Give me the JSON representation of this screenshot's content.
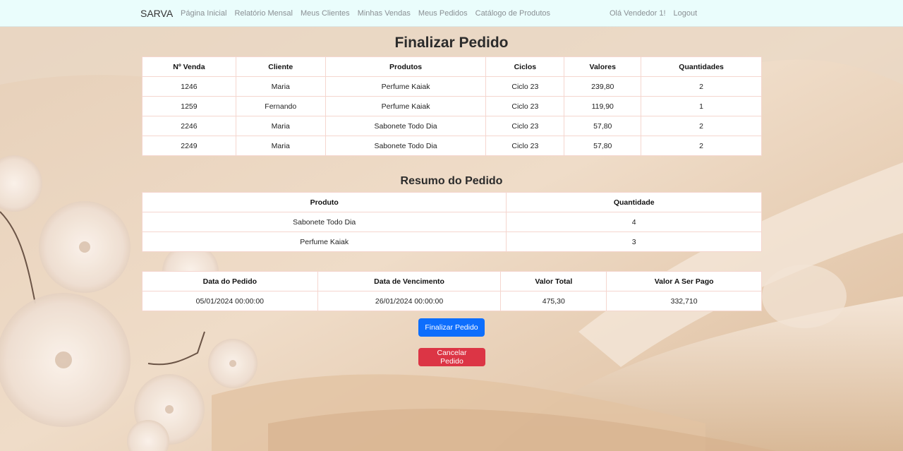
{
  "navbar": {
    "brand": "SARVA",
    "links": [
      "Página Inicial",
      "Relatório Mensal",
      "Meus Clientes",
      "Minhas Vendas",
      "Meus Pedidos",
      "Catálogo de Produtos"
    ],
    "greeting": "Olá Vendedor 1!",
    "logout": "Logout"
  },
  "page": {
    "title": "Finalizar Pedido",
    "summary_title": "Resumo do Pedido"
  },
  "sales_table": {
    "headers": [
      "Nº Venda",
      "Cliente",
      "Produtos",
      "Ciclos",
      "Valores",
      "Quantidades"
    ],
    "rows": [
      [
        "1246",
        "Maria",
        "Perfume Kaiak",
        "Ciclo 23",
        "239,80",
        "2"
      ],
      [
        "1259",
        "Fernando",
        "Perfume Kaiak",
        "Ciclo 23",
        "119,90",
        "1"
      ],
      [
        "2246",
        "Maria",
        "Sabonete Todo Dia",
        "Ciclo 23",
        "57,80",
        "2"
      ],
      [
        "2249",
        "Maria",
        "Sabonete Todo Dia",
        "Ciclo 23",
        "57,80",
        "2"
      ]
    ]
  },
  "summary_table": {
    "headers": [
      "Produto",
      "Quantidade"
    ],
    "rows": [
      [
        "Sabonete Todo Dia",
        "4"
      ],
      [
        "Perfume Kaiak",
        "3"
      ]
    ]
  },
  "totals_table": {
    "headers": [
      "Data do Pedido",
      "Data de Vencimento",
      "Valor Total",
      "Valor A Ser Pago"
    ],
    "rows": [
      [
        "05/01/2024 00:00:00",
        "26/01/2024 00:00:00",
        "475,30",
        "332,710"
      ]
    ]
  },
  "buttons": {
    "finalize": "Finalizar Pedido",
    "cancel": "Cancelar Pedido"
  },
  "colors": {
    "navbar_bg": "#eafdfc",
    "primary": "#0d6efd",
    "danger": "#dc3545",
    "table_border": "#f5d6cf"
  }
}
